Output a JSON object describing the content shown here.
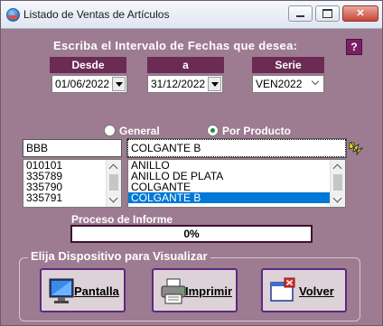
{
  "window": {
    "title": "Listado de Ventas de Artículos"
  },
  "heading": "Escriba el Intervalo de Fechas que desea:",
  "help_label": "?",
  "dates": {
    "from_label": "Desde",
    "to_label": "a",
    "serie_label": "Serie",
    "from_value": "01/06/2022",
    "to_value": "31/12/2022",
    "serie_value": "VEN2022"
  },
  "filter": {
    "general_label": "General",
    "product_label": "Por Producto",
    "selected": "product",
    "code_value": "BBB",
    "product_value": "COLGANTE B"
  },
  "code_list": [
    "010101",
    "335789",
    "335790",
    "335791"
  ],
  "product_list": [
    "ANILLO",
    "ANILLO DE PLATA",
    "COLGANTE",
    "COLGANTE B"
  ],
  "product_list_selected": 3,
  "progress": {
    "label": "Proceso de Informe",
    "text": "0%",
    "value": 0
  },
  "device": {
    "group_label": "Elija Dispositivo para Visualizar",
    "screen_label": "Pantalla",
    "print_label": "Imprimir",
    "back_label": "Volver"
  },
  "colors": {
    "window_bg": "#9d7b91",
    "label_bg": "#6b2b55",
    "selection": "#0078d7"
  }
}
